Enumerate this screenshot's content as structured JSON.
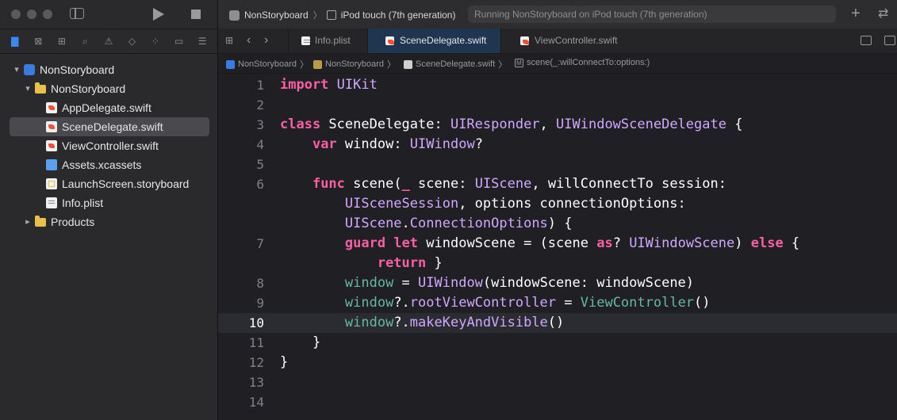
{
  "toolbar": {
    "scheme": "NonStoryboard",
    "destination": "iPod touch (7th generation)",
    "status": "Running NonStoryboard on iPod touch (7th generation)"
  },
  "navigator": {
    "items": [
      {
        "label": "NonStoryboard",
        "kind": "project",
        "level": 0,
        "expanded": true
      },
      {
        "label": "NonStoryboard",
        "kind": "folder",
        "level": 1,
        "expanded": true
      },
      {
        "label": "AppDelegate.swift",
        "kind": "swift",
        "level": 2
      },
      {
        "label": "SceneDelegate.swift",
        "kind": "swift",
        "level": 2,
        "selected": true
      },
      {
        "label": "ViewController.swift",
        "kind": "swift",
        "level": 2
      },
      {
        "label": "Assets.xcassets",
        "kind": "assets",
        "level": 2
      },
      {
        "label": "LaunchScreen.storyboard",
        "kind": "storyboard",
        "level": 2
      },
      {
        "label": "Info.plist",
        "kind": "plist",
        "level": 2
      },
      {
        "label": "Products",
        "kind": "folder",
        "level": 1,
        "expanded": false
      }
    ]
  },
  "tabs": [
    {
      "label": "Info.plist",
      "active": false
    },
    {
      "label": "SceneDelegate.swift",
      "active": true
    },
    {
      "label": "ViewController.swift",
      "active": false
    }
  ],
  "breadcrumb": [
    "NonStoryboard",
    "NonStoryboard",
    "SceneDelegate.swift",
    "scene(_:willConnectTo:options:)"
  ],
  "code": {
    "current_line": 10,
    "lines": [
      {
        "n": "1",
        "text": "import UIKit"
      },
      {
        "n": "2",
        "text": ""
      },
      {
        "n": "3",
        "text": "class SceneDelegate: UIResponder, UIWindowSceneDelegate {"
      },
      {
        "n": "4",
        "text": "    var window: UIWindow?"
      },
      {
        "n": "5",
        "text": ""
      },
      {
        "n": "6",
        "text": "    func scene(_ scene: UIScene, willConnectTo session:"
      },
      {
        "n": "",
        "text": "        UISceneSession, options connectionOptions:"
      },
      {
        "n": "",
        "text": "        UIScene.ConnectionOptions) {"
      },
      {
        "n": "7",
        "text": "        guard let windowScene = (scene as? UIWindowScene) else {"
      },
      {
        "n": "",
        "text": "            return }"
      },
      {
        "n": "8",
        "text": "        window = UIWindow(windowScene: windowScene)"
      },
      {
        "n": "9",
        "text": "        window?.rootViewController = ViewController()"
      },
      {
        "n": "10",
        "text": "        window?.makeKeyAndVisible()"
      },
      {
        "n": "11",
        "text": "    }"
      },
      {
        "n": "12",
        "text": "}"
      },
      {
        "n": "13",
        "text": ""
      },
      {
        "n": "14",
        "text": ""
      }
    ]
  },
  "colors": {
    "keyword": "#fc5fa3",
    "type": "#d0a8ff",
    "class_ref": "#67b7a4",
    "selection": "#1f3550",
    "nav_active": "#3b88f5"
  }
}
